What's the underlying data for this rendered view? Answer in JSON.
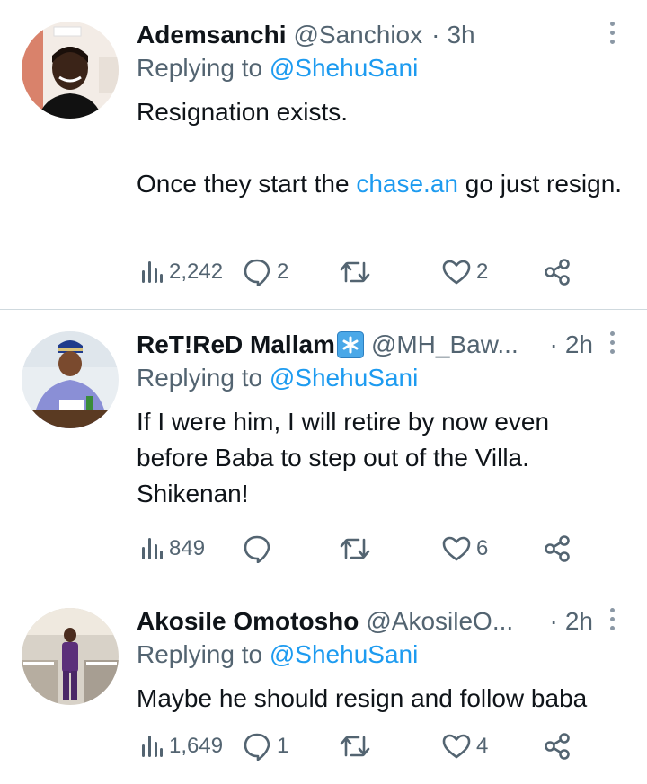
{
  "replies": [
    {
      "name": "Ademsanchi",
      "handle": "@Sanchiox",
      "dot": "·",
      "time": "3h",
      "replying_prefix": "Replying to",
      "replying_to": "@ShehuSani",
      "line1": "Resignation exists.",
      "line2_before": "Once they start the ",
      "line2_link": "chase.an",
      "line2_after": " go just resign.",
      "views": "2,242",
      "comments": "2",
      "retweets": "",
      "likes": "2"
    },
    {
      "name": "ReT!ReD Mallam",
      "handle": "@MH_Baw...",
      "dot": "·",
      "time": "2h",
      "replying_prefix": "Replying to",
      "replying_to": "@ShehuSani",
      "text": "If I were him, I will retire by now even before Baba to step out of the Villa. Shikenan!",
      "views": "849",
      "comments": "",
      "retweets": "",
      "likes": "6"
    },
    {
      "name": "Akosile Omotosho",
      "handle": "@AkosileO...",
      "dot": "·",
      "time": "2h",
      "replying_prefix": "Replying to",
      "replying_to": "@ShehuSani",
      "text": "Maybe he should resign and follow baba",
      "views": "1,649",
      "comments": "1",
      "retweets": "",
      "likes": "4"
    }
  ],
  "icons": {
    "views": "views-icon",
    "comment": "comment-icon",
    "retweet": "retweet-icon",
    "like": "heart-icon",
    "share": "share-icon",
    "more": "more-vertical-icon",
    "verified": "verified-asterisk-icon"
  },
  "colors": {
    "link": "#1d9bf0",
    "secondary_text": "#536471",
    "primary_text": "#0f1419",
    "divider": "#cfd9de"
  }
}
